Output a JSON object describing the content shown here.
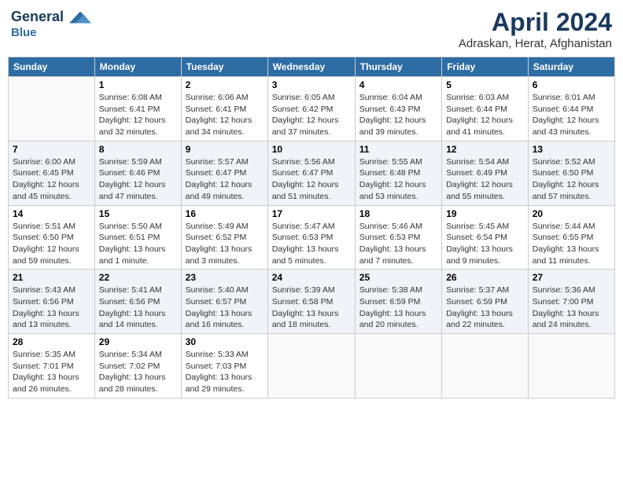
{
  "header": {
    "logo_line1": "General",
    "logo_line2": "Blue",
    "month_title": "April 2024",
    "location": "Adraskan, Herat, Afghanistan"
  },
  "weekdays": [
    "Sunday",
    "Monday",
    "Tuesday",
    "Wednesday",
    "Thursday",
    "Friday",
    "Saturday"
  ],
  "weeks": [
    [
      {
        "day": "",
        "info": ""
      },
      {
        "day": "1",
        "info": "Sunrise: 6:08 AM\nSunset: 6:41 PM\nDaylight: 12 hours\nand 32 minutes."
      },
      {
        "day": "2",
        "info": "Sunrise: 6:06 AM\nSunset: 6:41 PM\nDaylight: 12 hours\nand 34 minutes."
      },
      {
        "day": "3",
        "info": "Sunrise: 6:05 AM\nSunset: 6:42 PM\nDaylight: 12 hours\nand 37 minutes."
      },
      {
        "day": "4",
        "info": "Sunrise: 6:04 AM\nSunset: 6:43 PM\nDaylight: 12 hours\nand 39 minutes."
      },
      {
        "day": "5",
        "info": "Sunrise: 6:03 AM\nSunset: 6:44 PM\nDaylight: 12 hours\nand 41 minutes."
      },
      {
        "day": "6",
        "info": "Sunrise: 6:01 AM\nSunset: 6:44 PM\nDaylight: 12 hours\nand 43 minutes."
      }
    ],
    [
      {
        "day": "7",
        "info": "Sunrise: 6:00 AM\nSunset: 6:45 PM\nDaylight: 12 hours\nand 45 minutes."
      },
      {
        "day": "8",
        "info": "Sunrise: 5:59 AM\nSunset: 6:46 PM\nDaylight: 12 hours\nand 47 minutes."
      },
      {
        "day": "9",
        "info": "Sunrise: 5:57 AM\nSunset: 6:47 PM\nDaylight: 12 hours\nand 49 minutes."
      },
      {
        "day": "10",
        "info": "Sunrise: 5:56 AM\nSunset: 6:47 PM\nDaylight: 12 hours\nand 51 minutes."
      },
      {
        "day": "11",
        "info": "Sunrise: 5:55 AM\nSunset: 6:48 PM\nDaylight: 12 hours\nand 53 minutes."
      },
      {
        "day": "12",
        "info": "Sunrise: 5:54 AM\nSunset: 6:49 PM\nDaylight: 12 hours\nand 55 minutes."
      },
      {
        "day": "13",
        "info": "Sunrise: 5:52 AM\nSunset: 6:50 PM\nDaylight: 12 hours\nand 57 minutes."
      }
    ],
    [
      {
        "day": "14",
        "info": "Sunrise: 5:51 AM\nSunset: 6:50 PM\nDaylight: 12 hours\nand 59 minutes."
      },
      {
        "day": "15",
        "info": "Sunrise: 5:50 AM\nSunset: 6:51 PM\nDaylight: 13 hours\nand 1 minute."
      },
      {
        "day": "16",
        "info": "Sunrise: 5:49 AM\nSunset: 6:52 PM\nDaylight: 13 hours\nand 3 minutes."
      },
      {
        "day": "17",
        "info": "Sunrise: 5:47 AM\nSunset: 6:53 PM\nDaylight: 13 hours\nand 5 minutes."
      },
      {
        "day": "18",
        "info": "Sunrise: 5:46 AM\nSunset: 6:53 PM\nDaylight: 13 hours\nand 7 minutes."
      },
      {
        "day": "19",
        "info": "Sunrise: 5:45 AM\nSunset: 6:54 PM\nDaylight: 13 hours\nand 9 minutes."
      },
      {
        "day": "20",
        "info": "Sunrise: 5:44 AM\nSunset: 6:55 PM\nDaylight: 13 hours\nand 11 minutes."
      }
    ],
    [
      {
        "day": "21",
        "info": "Sunrise: 5:43 AM\nSunset: 6:56 PM\nDaylight: 13 hours\nand 13 minutes."
      },
      {
        "day": "22",
        "info": "Sunrise: 5:41 AM\nSunset: 6:56 PM\nDaylight: 13 hours\nand 14 minutes."
      },
      {
        "day": "23",
        "info": "Sunrise: 5:40 AM\nSunset: 6:57 PM\nDaylight: 13 hours\nand 16 minutes."
      },
      {
        "day": "24",
        "info": "Sunrise: 5:39 AM\nSunset: 6:58 PM\nDaylight: 13 hours\nand 18 minutes."
      },
      {
        "day": "25",
        "info": "Sunrise: 5:38 AM\nSunset: 6:59 PM\nDaylight: 13 hours\nand 20 minutes."
      },
      {
        "day": "26",
        "info": "Sunrise: 5:37 AM\nSunset: 6:59 PM\nDaylight: 13 hours\nand 22 minutes."
      },
      {
        "day": "27",
        "info": "Sunrise: 5:36 AM\nSunset: 7:00 PM\nDaylight: 13 hours\nand 24 minutes."
      }
    ],
    [
      {
        "day": "28",
        "info": "Sunrise: 5:35 AM\nSunset: 7:01 PM\nDaylight: 13 hours\nand 26 minutes."
      },
      {
        "day": "29",
        "info": "Sunrise: 5:34 AM\nSunset: 7:02 PM\nDaylight: 13 hours\nand 28 minutes."
      },
      {
        "day": "30",
        "info": "Sunrise: 5:33 AM\nSunset: 7:03 PM\nDaylight: 13 hours\nand 29 minutes."
      },
      {
        "day": "",
        "info": ""
      },
      {
        "day": "",
        "info": ""
      },
      {
        "day": "",
        "info": ""
      },
      {
        "day": "",
        "info": ""
      }
    ]
  ]
}
